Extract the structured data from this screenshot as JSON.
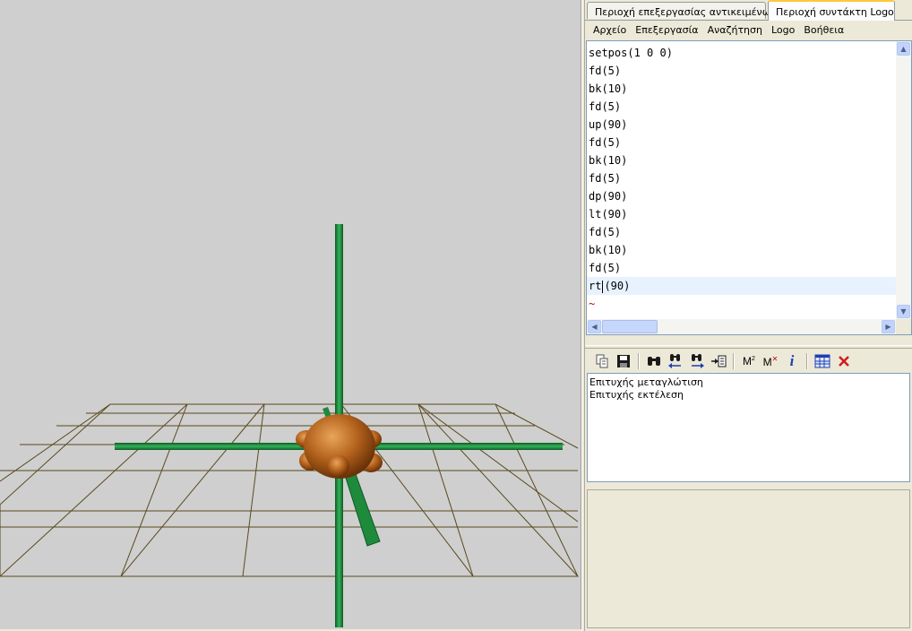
{
  "tabs": [
    {
      "label": "Περιοχή επεξεργασίας αντικειμένων",
      "icon": "objects-icon",
      "active": false
    },
    {
      "label": "Περιοχή συντάκτη Logo",
      "icon": "logo-editor-icon",
      "active": true
    }
  ],
  "menu": [
    "Αρχείο",
    "Επεξεργασία",
    "Αναζήτηση",
    "Logo",
    "Βοήθεια"
  ],
  "editor": {
    "lines": [
      "setpos(1 0 0)",
      "fd(5)",
      "bk(10)",
      "fd(5)",
      "up(90)",
      "fd(5)",
      "bk(10)",
      "fd(5)",
      "dp(90)",
      "lt(90)",
      "fd(5)",
      "bk(10)",
      "fd(5)"
    ],
    "current_line_before_caret": "rt",
    "current_line_after_caret": "(90)",
    "end_marker": "~"
  },
  "toolbar": {
    "buttons": [
      {
        "name": "copy-icon",
        "glyph": "⎘"
      },
      {
        "name": "save-icon",
        "glyph": "💾"
      },
      {
        "name": "find-icon",
        "glyph": "🔍"
      },
      {
        "name": "find-previous-icon",
        "glyph": "🔍"
      },
      {
        "name": "find-next-icon",
        "glyph": "🔍"
      },
      {
        "name": "goto-line-icon",
        "glyph": "⇥"
      },
      {
        "name": "memory-icon",
        "glyph": "M²"
      },
      {
        "name": "memory-clear-icon",
        "glyph": "M✕"
      },
      {
        "name": "info-icon",
        "glyph": "i"
      },
      {
        "name": "table-icon",
        "glyph": "▦"
      },
      {
        "name": "close-icon",
        "glyph": "✕"
      }
    ]
  },
  "output": {
    "messages": [
      "Επιτυχής μεταγλώτιση",
      "Επιτυχής εκτέλεση"
    ]
  },
  "colors": {
    "viewport_bg": "#cfcfcf",
    "grid_line": "#5a4a1e",
    "axis_green": "#1e8a3c",
    "turtle_brown": "#b3621c",
    "current_line_bg": "#e8f2fe"
  }
}
